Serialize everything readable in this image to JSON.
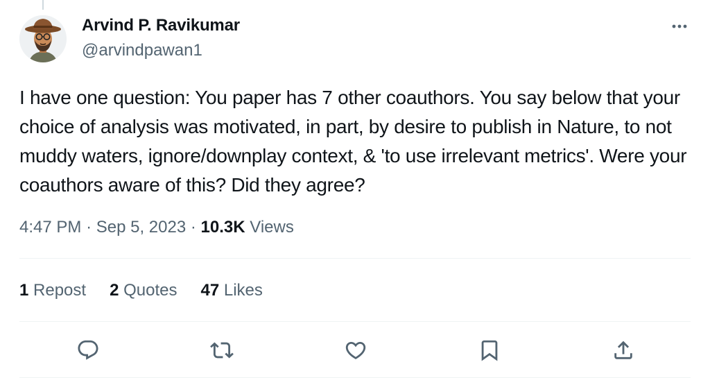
{
  "author": {
    "name": "Arvind P. Ravikumar",
    "handle": "@arvindpawan1"
  },
  "tweet": {
    "text": "I have one question: You paper has 7 other coauthors. You say below that your choice of analysis was motivated, in part, by desire to publish in Nature, to not muddy waters, ignore/downplay context, & 'to use irrelevant metrics'. Were your coauthors aware of this? Did they agree?"
  },
  "meta": {
    "time": "4:47 PM",
    "separator": "·",
    "date": "Sep 5, 2023",
    "views_count": "10.3K",
    "views_label": "Views"
  },
  "stats": {
    "reposts_count": "1",
    "reposts_label": "Repost",
    "quotes_count": "2",
    "quotes_label": "Quotes",
    "likes_count": "47",
    "likes_label": "Likes"
  },
  "actions": {
    "icons": [
      "reply-icon",
      "retweet-icon",
      "like-icon",
      "bookmark-icon",
      "share-icon"
    ]
  },
  "colors": {
    "text": "#0f1419",
    "secondary": "#536471",
    "divider": "#eff3f4"
  }
}
